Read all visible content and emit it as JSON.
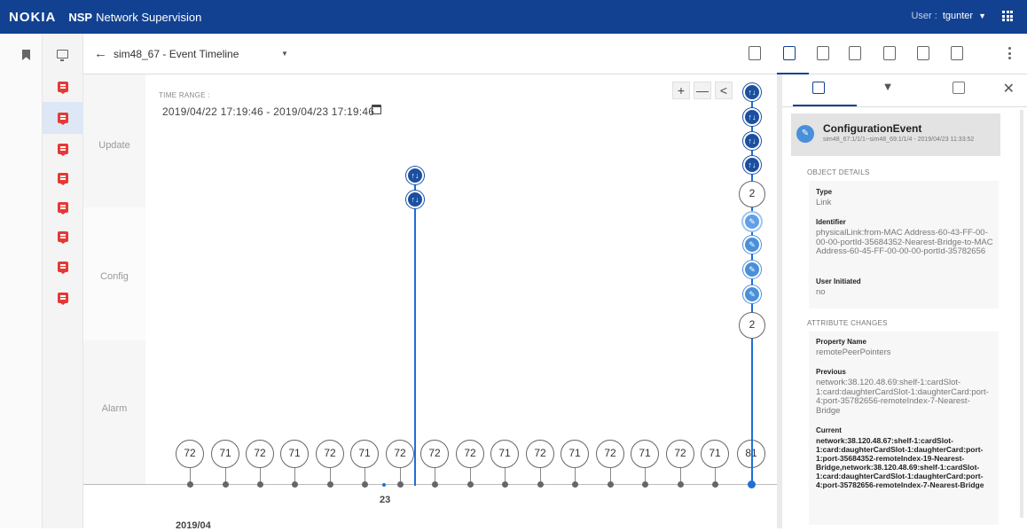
{
  "topbar": {
    "brand": "NOKIA",
    "app_name_bold": "NSP",
    "app_name": "Network Supervision",
    "user_label": "User :",
    "user_name": "tgunter"
  },
  "header": {
    "title": "sim48_67 - Event Timeline"
  },
  "lanes": [
    "Update",
    "Config",
    "Alarm"
  ],
  "time_range": {
    "label": "TIME RANGE :",
    "value": "2019/04/22 17:19:46 - 2019/04/23 17:19:46"
  },
  "zoom": {
    "plus": "+",
    "minus": "—",
    "prev": "<"
  },
  "counts": [
    "72",
    "71",
    "72",
    "71",
    "72",
    "71",
    "72",
    "72",
    "72",
    "71",
    "72",
    "71",
    "72",
    "71",
    "72",
    "71",
    "81"
  ],
  "cluster_counts": {
    "update": "2",
    "config": "2"
  },
  "x_label": "23",
  "month_label": "2019/04",
  "right_panel": {
    "event_title": "ConfigurationEvent",
    "event_sub": "sim48_67:1/1/1--sim48_69:1/1/4 - 2019/04/23 11:33:52",
    "object_details": "OBJECT DETAILS",
    "type_key": "Type",
    "type_val": "Link",
    "id_key": "Identifier",
    "id_val": "physicalLink:from-MAC Address-60-43-FF-00-00-00-portId-35684352-Nearest-Bridge-to-MAC Address-60-45-FF-00-00-00-portId-35782656",
    "user_key": "User Initiated",
    "user_val": "no",
    "attr_changes": "ATTRIBUTE CHANGES",
    "prop_key": "Property Name",
    "prop_val": "remotePeerPointers",
    "prev_key": "Previous",
    "prev_val": "network:38.120.48.69:shelf-1:cardSlot-1:card:daughterCardSlot-1:daughterCard:port-4:port-35782656-remoteIndex-7-Nearest-Bridge",
    "cur_key": "Current",
    "cur_val": "network:38.120.48.67:shelf-1:cardSlot-1:card:daughterCardSlot-1:daughterCard:port-1:port-35684352-remoteIndex-19-Nearest-Bridge,network:38.120.48.69:shelf-1:cardSlot-1:card:daughterCardSlot-1:daughterCard:port-4:port-35782656-remoteIndex-7-Nearest-Bridge"
  },
  "colors": {
    "topbar": "#124191",
    "event_red": "#e53935",
    "timeline_blue": "#1e6fd9",
    "update_circle": "#1b4fa0",
    "config_circle": "#4a8fd9"
  }
}
